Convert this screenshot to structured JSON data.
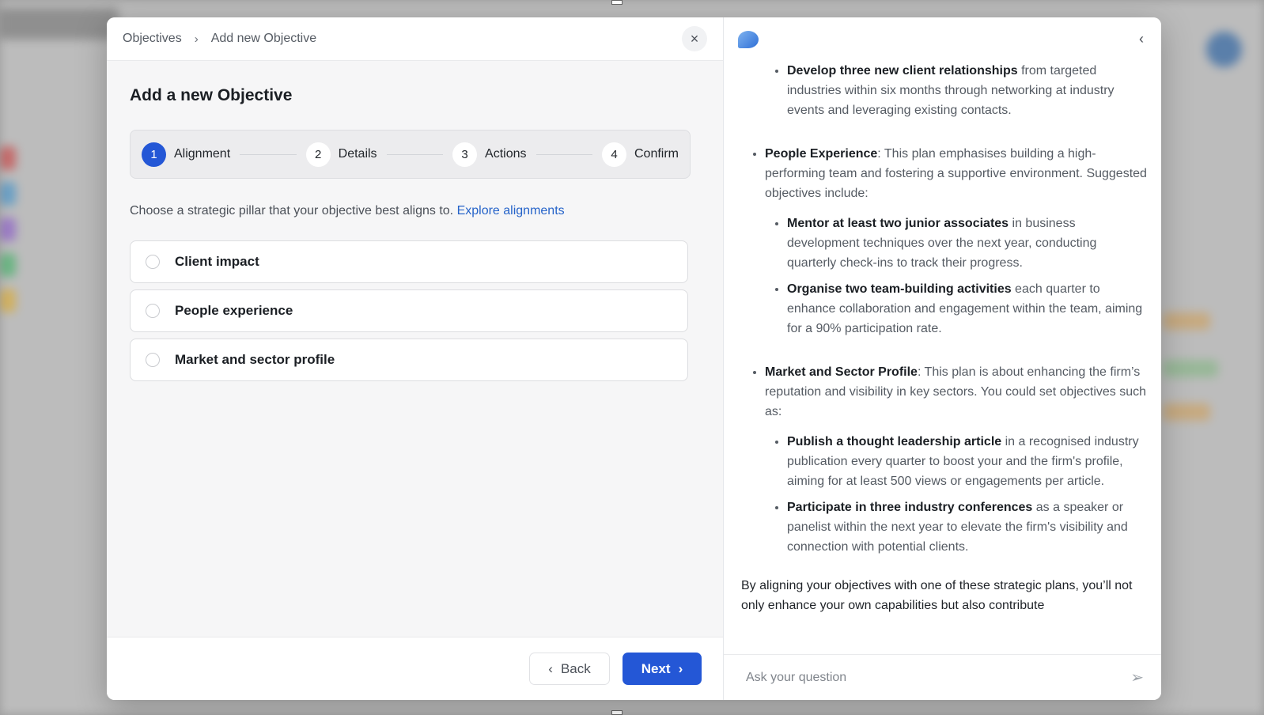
{
  "breadcrumb": {
    "root": "Objectives",
    "separator": "›",
    "current": "Add new Objective"
  },
  "close_icon": "×",
  "page_title": "Add a new Objective",
  "steps": [
    {
      "num": "1",
      "label": "Alignment",
      "active": true
    },
    {
      "num": "2",
      "label": "Details"
    },
    {
      "num": "3",
      "label": "Actions"
    },
    {
      "num": "4",
      "label": "Confirm"
    }
  ],
  "intro": {
    "text": "Choose a strategic pillar that your objective best aligns to.",
    "link": "Explore alignments"
  },
  "options": [
    {
      "label": "Client impact"
    },
    {
      "label": "People experience"
    },
    {
      "label": "Market and sector profile"
    }
  ],
  "footer": {
    "back_label": "Back",
    "back_icon": "‹",
    "next_label": "Next",
    "next_icon": "›"
  },
  "assistant": {
    "collapse_icon": "‹",
    "first_item": {
      "bold": "Develop three new client relationships",
      "rest": " from targeted industries within six months through networking at industry events and leveraging existing contacts."
    },
    "sections": [
      {
        "bold": "People Experience",
        "rest": ": This plan emphasises building a high-performing team and fostering a supportive environment. Suggested objectives include:",
        "items": [
          {
            "bold": "Mentor at least two junior associates",
            "rest": " in business development techniques over the next year, conducting quarterly check-ins to track their progress."
          },
          {
            "bold": "Organise two team-building activities",
            "rest": " each quarter to enhance collaboration and engagement within the team, aiming for a 90% participation rate."
          }
        ]
      },
      {
        "bold": "Market and Sector Profile",
        "rest": ": This plan is about enhancing the firm’s reputation and visibility in key sectors. You could set objectives such as:",
        "items": [
          {
            "bold": "Publish a thought leadership article",
            "rest": " in a recognised industry publication every quarter to boost your and the firm's profile, aiming for at least 500 views or engagements per article."
          },
          {
            "bold": "Participate in three industry conferences",
            "rest": " as a speaker or panelist within the next year to elevate the firm's visibility and connection with potential clients."
          }
        ]
      }
    ],
    "closing": "By aligning your objectives with one of these strategic plans, you’ll not only enhance your own capabilities but also contribute",
    "ask_placeholder": "Ask your question",
    "send_icon": "➢"
  }
}
